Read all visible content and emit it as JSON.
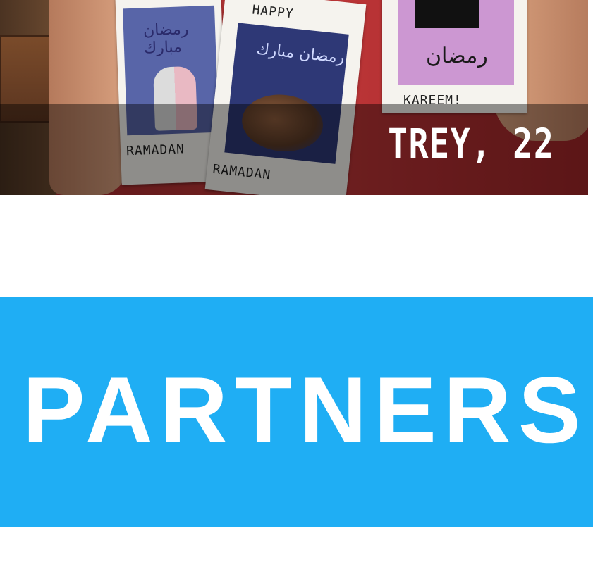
{
  "photo": {
    "caption": "TREY, 22",
    "card1": {
      "bottom_text": "RAMADAN",
      "arabic": "رمضان مبارك"
    },
    "card2": {
      "top_text": "HAPPY",
      "bottom_text": "RAMADAN",
      "arabic": "رمضان مبارك"
    },
    "card3": {
      "bottom_text": "KAREEM!",
      "arabic": "رمضان"
    }
  },
  "banner": {
    "title": "PARTNERS",
    "background_color": "#1faef4",
    "text_color": "#ffffff"
  }
}
